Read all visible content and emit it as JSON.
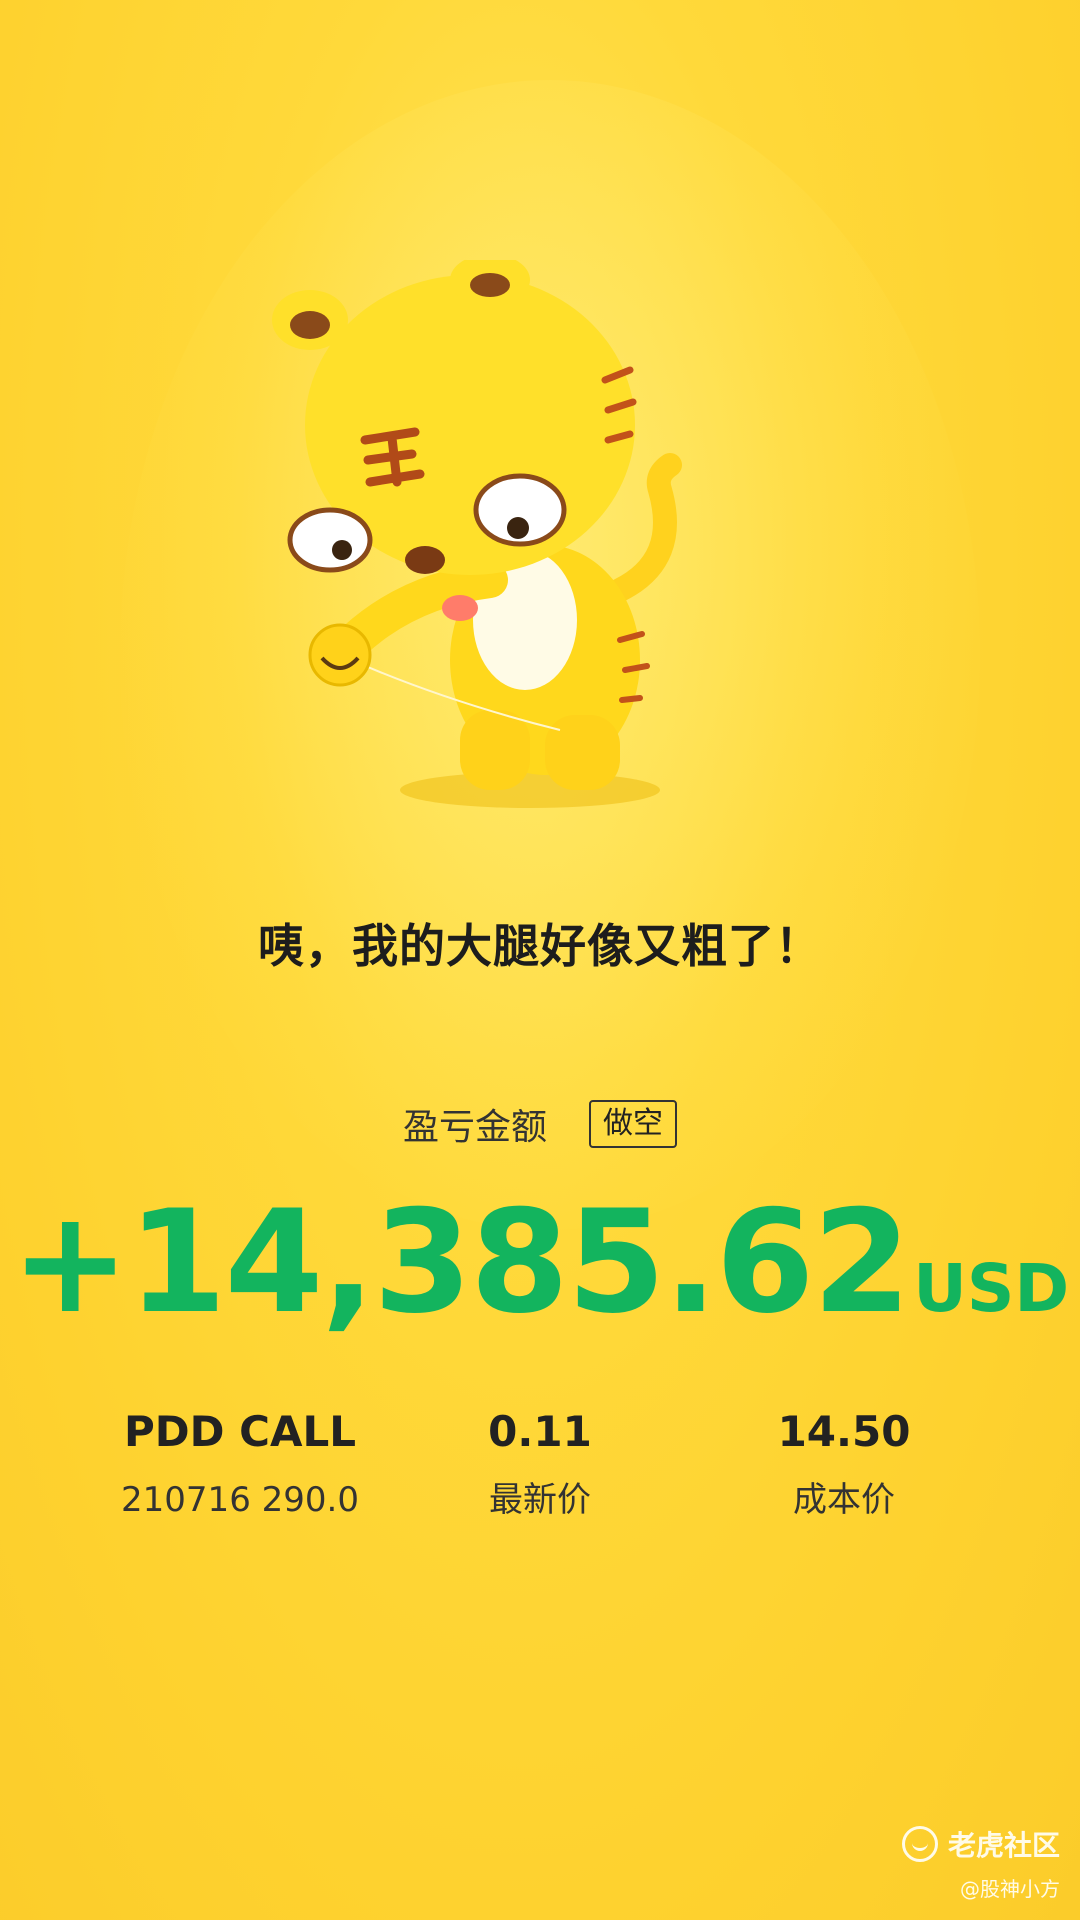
{
  "headline": "咦，我的大腿好像又粗了！",
  "pnl": {
    "label": "盈亏金额",
    "side_badge": "做空",
    "amount": "+14,385.62",
    "currency": "USD",
    "color": "#13b45e"
  },
  "position": {
    "symbol": "PDD CALL",
    "contract": "210716 290.0",
    "latest_price": "0.11",
    "latest_price_label": "最新价",
    "cost_price": "14.50",
    "cost_price_label": "成本价"
  },
  "footer": {
    "brand": "老虎社区",
    "handle": "@股神小方",
    "icon": "tiger-logo-icon"
  },
  "mascot": {
    "icon": "tiger-mascot-icon"
  },
  "colors": {
    "background": "#fed22f",
    "profit_green": "#13b45e"
  }
}
